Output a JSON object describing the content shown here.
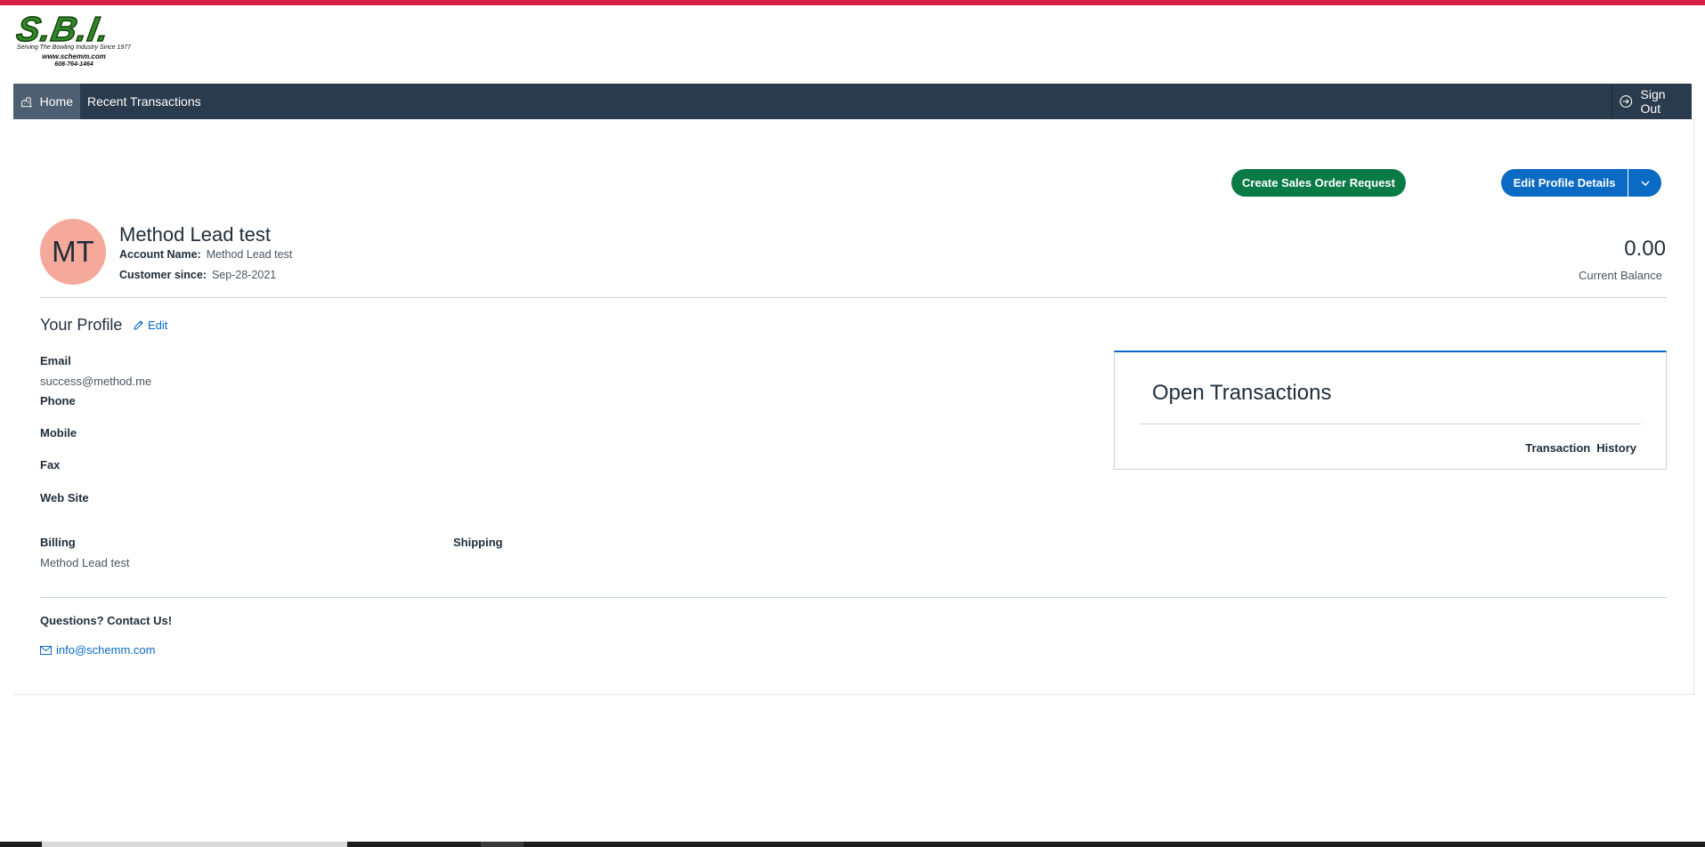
{
  "logo": {
    "mark": "S.B.I.",
    "tagline": "Serving The Bowling Industry Since 1977",
    "website": "www.schemm.com",
    "phone": "608-764-1464"
  },
  "nav": {
    "home": "Home",
    "recent_transactions": "Recent Transactions",
    "sign_out": "Sign Out"
  },
  "actions": {
    "create_sales_order": "Create Sales Order Request",
    "edit_profile_details": "Edit Profile Details"
  },
  "customer": {
    "initials": "MT",
    "name": "Method Lead test",
    "account_name_label": "Account Name:",
    "account_name": "Method Lead test",
    "customer_since_label": "Customer since:",
    "customer_since": "Sep-28-2021",
    "balance": "0.00",
    "balance_label": "Current Balance"
  },
  "profile": {
    "title": "Your Profile",
    "edit": "Edit",
    "email_label": "Email",
    "email": "success@method.me",
    "phone_label": "Phone",
    "mobile_label": "Mobile",
    "fax_label": "Fax",
    "website_label": "Web Site",
    "billing_label": "Billing",
    "billing_value": "Method Lead test",
    "shipping_label": "Shipping"
  },
  "open_transactions": {
    "title": "Open Transactions",
    "transaction": "Transaction",
    "history": "History"
  },
  "contact": {
    "title": "Questions? Contact Us!",
    "email": "info@schemm.com"
  },
  "colors": {
    "top_stripe": "#d91e48",
    "navbar": "#2a3b4d",
    "green_button": "#0a7b44",
    "blue_button": "#0b6bc4",
    "avatar": "#f5a99a"
  }
}
